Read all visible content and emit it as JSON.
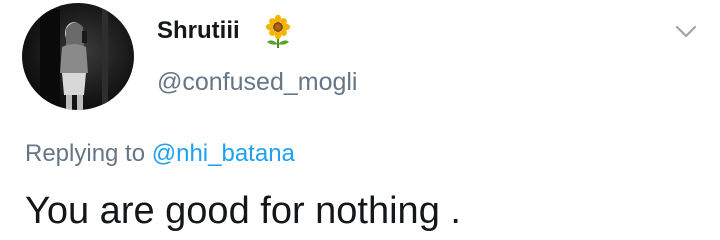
{
  "author": {
    "display_name": "Shrutiii",
    "name_emoji_icon": "sunflower-icon",
    "handle": "@confused_mogli",
    "avatar_icon": "profile-photo"
  },
  "menu": {
    "icon": "chevron-down-icon"
  },
  "reply": {
    "prefix": "Replying to",
    "target": "@nhi_batana"
  },
  "tweet": {
    "text": "You are good for nothing ."
  },
  "colors": {
    "text_primary": "#14171a",
    "text_secondary": "#657786",
    "link": "#1da1f2",
    "background": "#ffffff"
  }
}
